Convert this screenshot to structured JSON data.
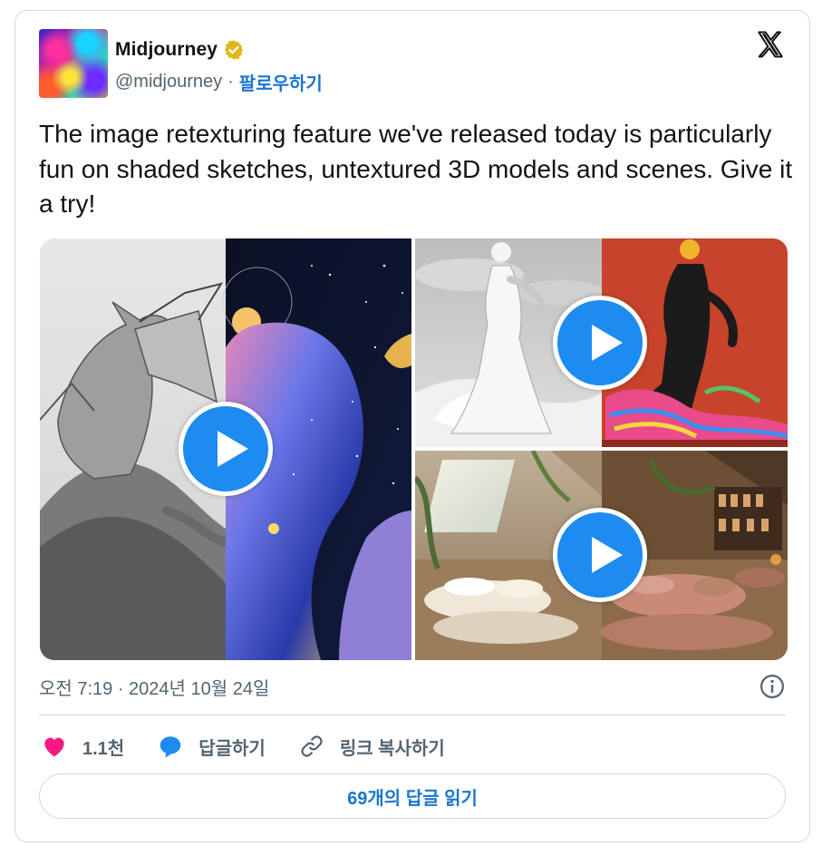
{
  "author": {
    "name": "Midjourney",
    "handle": "@midjourney",
    "separator": "·",
    "follow_label": "팔로우하기"
  },
  "tweet": {
    "text": "The image retexturing feature we've released today is particularly fun on shaded sketches, untextured 3D models and scenes. Give it a try!"
  },
  "media": {
    "items": [
      {
        "name": "dragon sketch to space painting"
      },
      {
        "name": "sculpture to colorful dress"
      },
      {
        "name": "attic room retexture"
      }
    ]
  },
  "meta": {
    "timestamp": "오전 7:19 · 2024년 10월 24일"
  },
  "actions": {
    "likes": "1.1천",
    "reply_label": "답글하기",
    "copy_link_label": "링크 복사하기"
  },
  "replies_button": "69개의 답글 읽기",
  "colors": {
    "accent": "#1d8bf0",
    "link": "#1d74d0",
    "like": "#f91880",
    "verified": "#e2b719"
  }
}
